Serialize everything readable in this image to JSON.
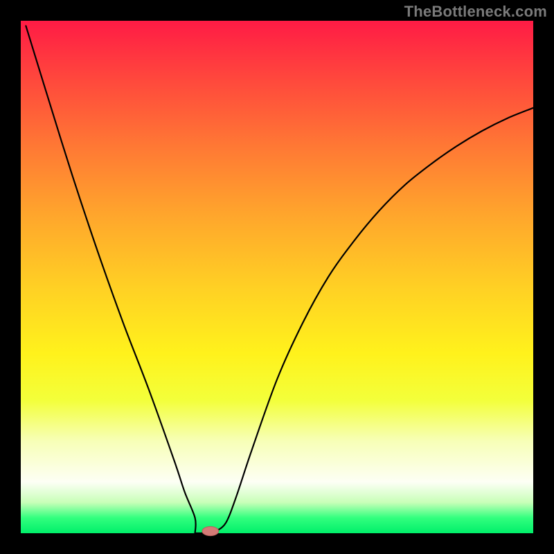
{
  "watermark": "TheBottleneck.com",
  "colors": {
    "frame_bg": "#000000",
    "watermark": "#7a7a7a",
    "curve": "#000000",
    "marker_fill": "#d47a76",
    "marker_stroke": "#b85f5c"
  },
  "chart_data": {
    "type": "line",
    "title": "",
    "xlabel": "",
    "ylabel": "",
    "xlim": [
      0,
      100
    ],
    "ylim": [
      0,
      100
    ],
    "grid": false,
    "legend": false,
    "annotations": [],
    "series": [
      {
        "name": "bottleneck-curve",
        "x": [
          1,
          5,
          10,
          15,
          20,
          25,
          30,
          32,
          34,
          36,
          37,
          38,
          40,
          42,
          45,
          50,
          55,
          60,
          65,
          70,
          75,
          80,
          85,
          90,
          95,
          100
        ],
        "y": [
          99,
          86,
          70,
          55,
          41,
          28,
          14,
          8,
          3,
          0.5,
          0,
          0.3,
          2,
          7,
          16,
          30,
          41,
          50,
          57,
          63,
          68,
          72,
          75.5,
          78.5,
          81,
          83
        ]
      }
    ],
    "flat_segment": {
      "x_start": 34,
      "x_end": 38,
      "y": 0
    },
    "marker": {
      "x": 37,
      "y": 0,
      "rx": 1.6,
      "ry": 0.9
    }
  }
}
